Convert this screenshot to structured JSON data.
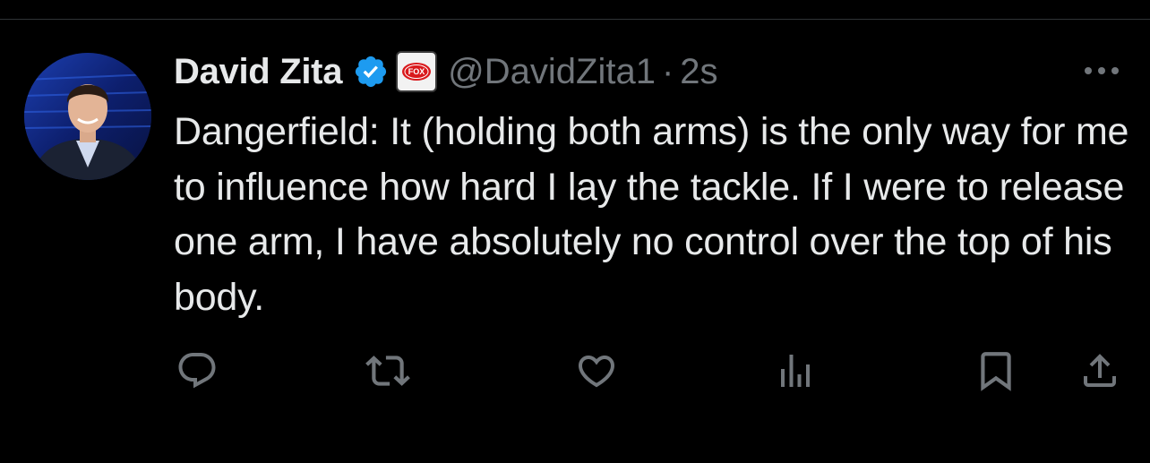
{
  "tweet": {
    "display_name": "David Zita",
    "handle": "@DavidZita1",
    "separator": "·",
    "timestamp": "2s",
    "affiliate_badge_text": "FOX",
    "text": "Dangerfield: It (holding both arms) is the only way for me to influence how hard I lay the tackle. If I were to release one arm, I have absolutely no control over the top of his body."
  },
  "icons": {
    "verified": "verified-check-icon",
    "affiliate": "fox-footy-badge-icon",
    "more": "more-dots-icon",
    "reply": "reply-icon",
    "retweet": "retweet-icon",
    "like": "heart-icon",
    "views": "views-bar-chart-icon",
    "bookmark": "bookmark-icon",
    "share": "share-icon"
  },
  "colors": {
    "background": "#000000",
    "text_primary": "#e7e9ea",
    "text_secondary": "#71767b",
    "verified_blue": "#1d9bf0",
    "fox_red": "#d9191c"
  }
}
